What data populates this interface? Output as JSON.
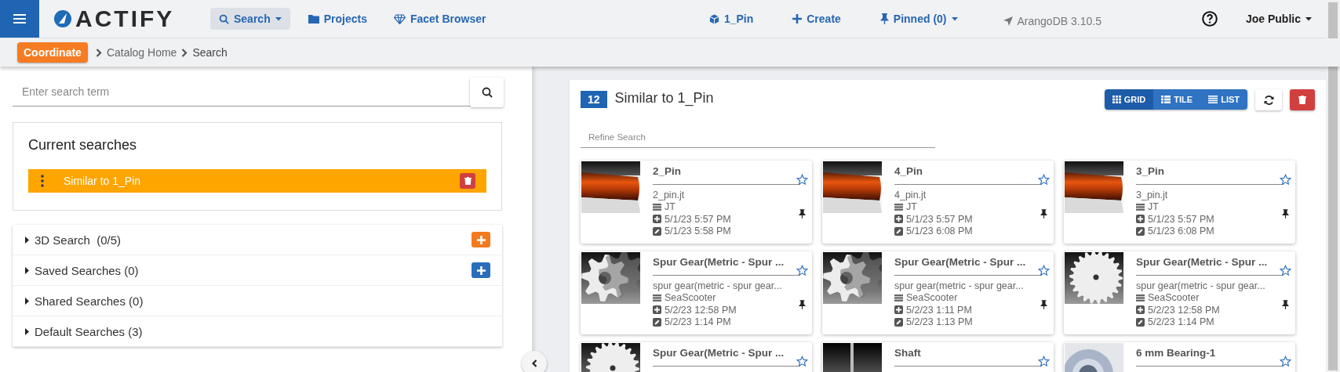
{
  "navbar": {
    "logo": "ACTIFY",
    "nav": [
      {
        "label": "Search",
        "dropdown": true,
        "selected": true
      },
      {
        "label": "Projects",
        "dropdown": false,
        "selected": false
      },
      {
        "label": "Facet Browser",
        "dropdown": false,
        "selected": false
      }
    ],
    "right": [
      {
        "kind": "link",
        "label": "1_Pin",
        "dropdown": false
      },
      {
        "kind": "link",
        "label": "Create",
        "dropdown": false
      },
      {
        "kind": "link",
        "label": "Pinned (0)",
        "dropdown": true
      },
      {
        "kind": "info",
        "label": "ArangoDB 3.10.5",
        "dropdown": false
      },
      {
        "kind": "help"
      },
      {
        "kind": "user",
        "label": "Joe Public",
        "dropdown": true
      }
    ]
  },
  "breadcrumb": {
    "badge": "Coordinate",
    "items": [
      "Catalog Home",
      "Search"
    ]
  },
  "left": {
    "search": {
      "placeholder": "Enter search term"
    },
    "current": {
      "title": "Current searches",
      "items": [
        {
          "label": "Similar to 1_Pin",
          "selected": true
        }
      ]
    },
    "sections": [
      {
        "label": "3D Search  (0/5)",
        "expanded": false,
        "color": "#f47a20"
      },
      {
        "label": "Saved Searches (0)",
        "expanded": false,
        "color": "#2a6ebb"
      },
      {
        "label": "Shared Searches (0)",
        "expanded": false
      },
      {
        "label": "Default Searches (3)",
        "expanded": false
      }
    ]
  },
  "results": {
    "count": "12",
    "title": "Similar to 1_Pin",
    "views": [
      {
        "label": "GRID",
        "selected": true
      },
      {
        "label": "TILE",
        "selected": false
      },
      {
        "label": "LIST",
        "selected": false
      }
    ],
    "refine": {
      "placeholder": "Refine Search"
    },
    "items": [
      {
        "title": "2_Pin",
        "file": "2_pin.jt",
        "source": "JT",
        "created": "5/1/23 5:57 PM",
        "modified": "5/1/23 5:58 PM",
        "starred": false,
        "pinned": true
      },
      {
        "title": "4_Pin",
        "file": "4_pin.jt",
        "source": "JT",
        "created": "5/1/23 5:57 PM",
        "modified": "5/1/23 6:08 PM",
        "starred": false,
        "pinned": true
      },
      {
        "title": "3_Pin",
        "file": "3_pin.jt",
        "source": "JT",
        "created": "5/1/23 5:57 PM",
        "modified": "5/1/23 6:08 PM",
        "starred": false,
        "pinned": true
      },
      {
        "title": "Spur Gear(Metric - Spur ...",
        "file": "spur gear(metric - spur gear...",
        "source": "SeaScooter",
        "created": "5/2/23 12:58 PM",
        "modified": "5/2/23 1:14 PM",
        "starred": false,
        "pinned": true
      },
      {
        "title": "Spur Gear(Metric - Spur ...",
        "file": "spur gear(metric - spur gear...",
        "source": "SeaScooter",
        "created": "5/2/23 1:11 PM",
        "modified": "5/2/23 1:13 PM",
        "starred": false,
        "pinned": true
      },
      {
        "title": "Spur Gear(Metric - Spur ...",
        "file": "spur gear(metric - spur gear...",
        "source": "SeaScooter",
        "created": "5/2/23 12:58 PM",
        "modified": "5/2/23 1:14 PM",
        "starred": false,
        "pinned": true
      },
      {
        "title": "Spur Gear(Metric - Spur ...",
        "starred": false
      },
      {
        "title": "Shaft",
        "starred": false
      },
      {
        "title": "6 mm Bearing-1",
        "starred": false
      }
    ]
  }
}
